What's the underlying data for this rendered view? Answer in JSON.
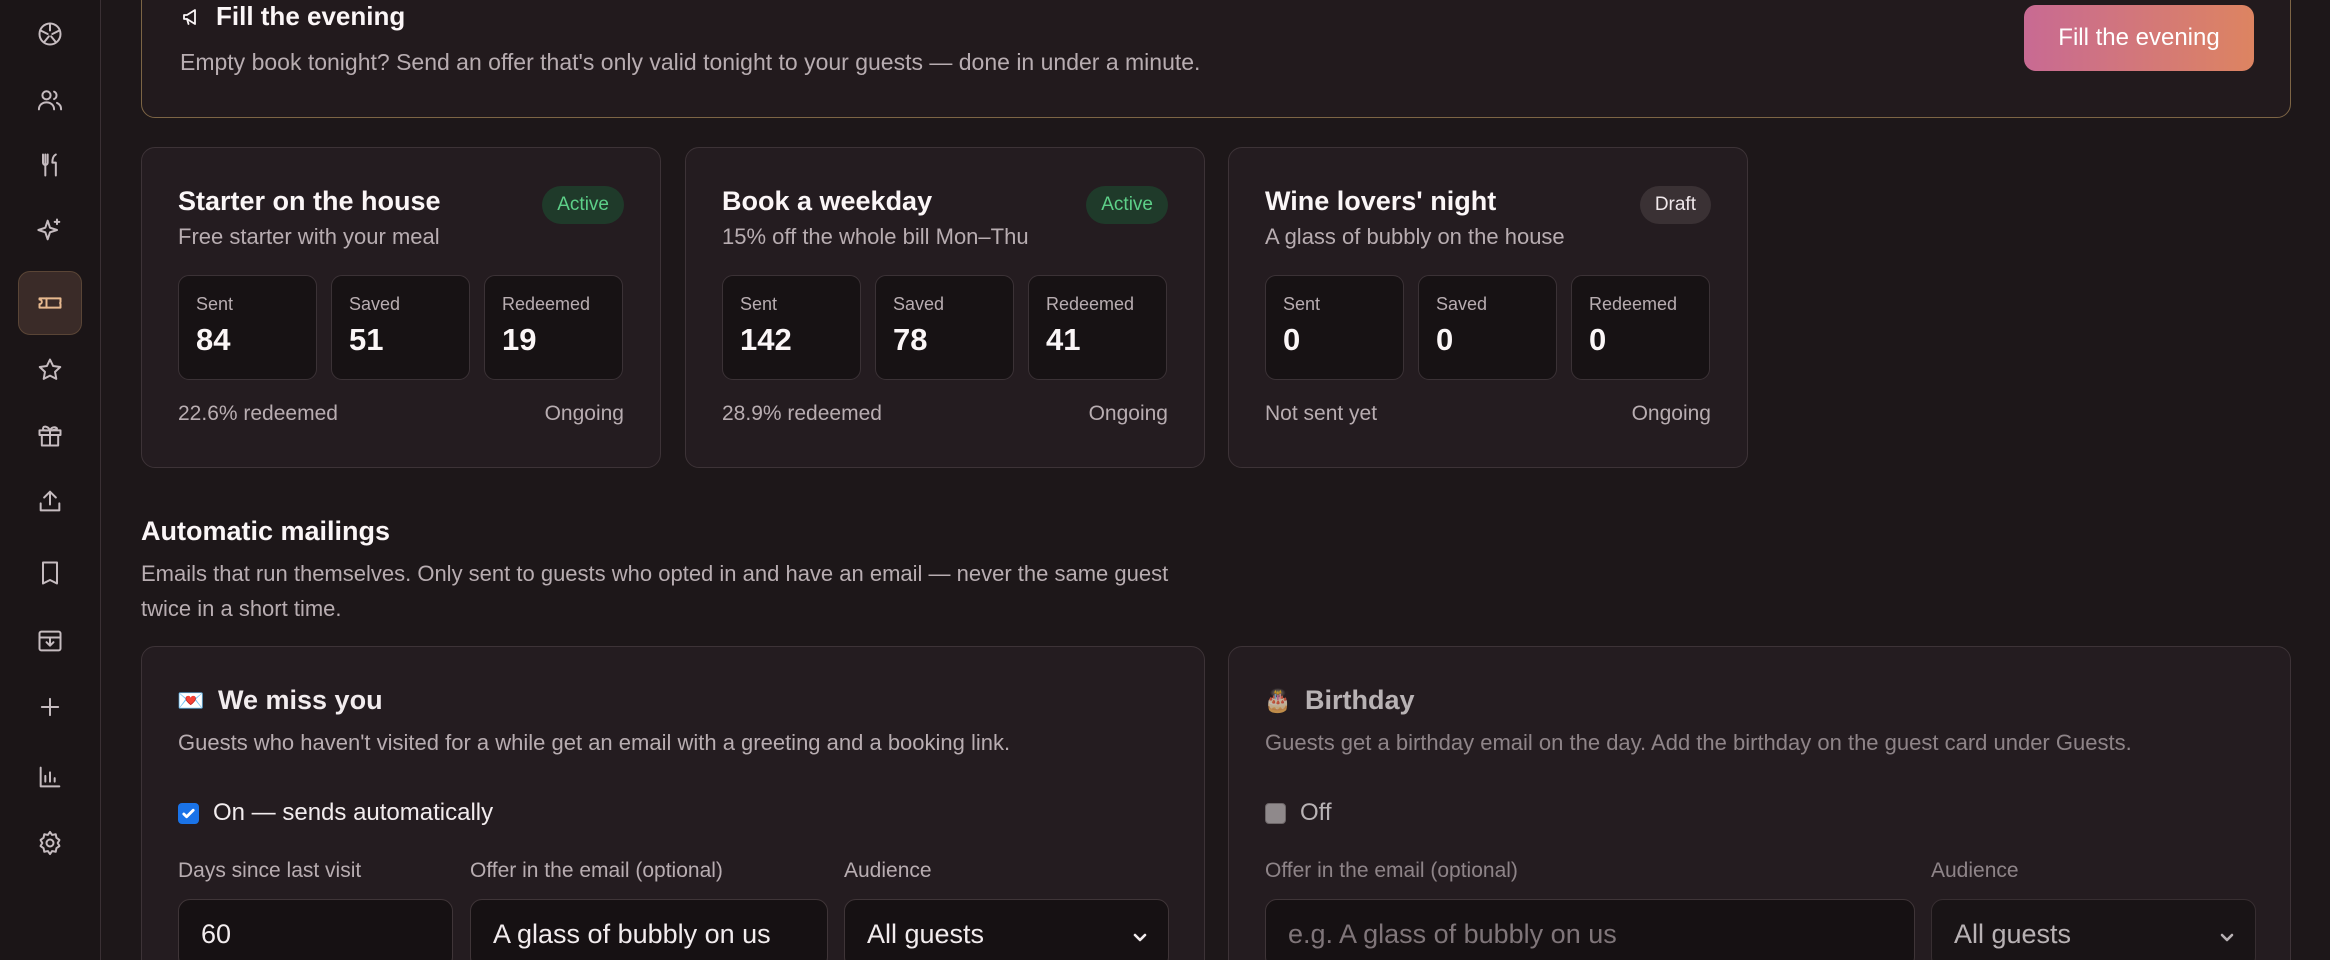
{
  "sidebar": {
    "icons": [
      "dashboard-icon",
      "guests-icon",
      "utensils-icon",
      "sparkles-icon",
      "ticket-icon",
      "star-icon",
      "gift-icon",
      "upload-icon",
      "book-icon",
      "archive-icon",
      "plus-icon",
      "chart-icon",
      "settings-icon"
    ],
    "active_index": 4
  },
  "banner": {
    "title": "Fill the evening",
    "text": "Empty book tonight? Send an offer that's only valid tonight to your guests — done in under a minute.",
    "button": "Fill the evening"
  },
  "offers": [
    {
      "title": "Starter on the house",
      "subtitle": "Free starter with your meal",
      "status": "Active",
      "sent_label": "Sent",
      "sent": "84",
      "saved_label": "Saved",
      "saved": "51",
      "redeemed_label": "Redeemed",
      "redeemed": "19",
      "rate": "22.6% redeemed",
      "duration": "Ongoing"
    },
    {
      "title": "Book a weekday",
      "subtitle": "15% off the whole bill Mon–Thu",
      "status": "Active",
      "sent_label": "Sent",
      "sent": "142",
      "saved_label": "Saved",
      "saved": "78",
      "redeemed_label": "Redeemed",
      "redeemed": "41",
      "rate": "28.9% redeemed",
      "duration": "Ongoing"
    },
    {
      "title": "Wine lovers' night",
      "subtitle": "A glass of bubbly on the house",
      "status": "Draft",
      "sent_label": "Sent",
      "sent": "0",
      "saved_label": "Saved",
      "saved": "0",
      "redeemed_label": "Redeemed",
      "redeemed": "0",
      "rate": "Not sent yet",
      "duration": "Ongoing"
    }
  ],
  "mailings": {
    "title": "Automatic mailings",
    "description": "Emails that run themselves. Only sent to guests who opted in and have an email — never the same guest twice in a short time."
  },
  "we_miss_you": {
    "emoji": "💌",
    "title": "We miss you",
    "description": "Guests who haven't visited for a while get an email with a greeting and a booking link.",
    "enabled": true,
    "toggle_label": "On — sends automatically",
    "days_label": "Days since last visit",
    "days_value": "60",
    "offer_label": "Offer in the email (optional)",
    "offer_value": "A glass of bubbly on us",
    "audience_label": "Audience",
    "audience_value": "All guests"
  },
  "birthday": {
    "emoji": "🎂",
    "title": "Birthday",
    "description": "Guests get a birthday email on the day. Add the birthday on the guest card under Guests.",
    "enabled": false,
    "toggle_label": "Off",
    "offer_label": "Offer in the email (optional)",
    "offer_placeholder": "e.g. A glass of bubbly on us",
    "audience_label": "Audience",
    "audience_value": "All guests"
  },
  "colors": {
    "background": "#1d1719",
    "card": "#241c20",
    "accent_gradient_start": "#c86a93",
    "accent_gradient_end": "#dd8461",
    "active_badge": "#5dcf88",
    "checkbox": "#1a73e8"
  }
}
